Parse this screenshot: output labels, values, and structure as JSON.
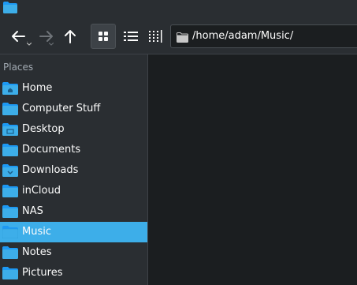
{
  "window": {
    "app_icon": "folder-icon"
  },
  "toolbar": {
    "back_icon": "back-arrow-icon",
    "forward_icon": "forward-arrow-icon",
    "up_icon": "up-arrow-icon",
    "view_modes": [
      "icons-view-icon",
      "details-view-icon",
      "compact-view-icon"
    ],
    "active_view": "icons-view-icon",
    "path": "/home/adam/Music/"
  },
  "sidebar": {
    "heading": "Places",
    "items": [
      {
        "label": "Home",
        "icon": "home-folder-icon",
        "selected": false
      },
      {
        "label": "Computer Stuff",
        "icon": "folder-icon",
        "selected": false
      },
      {
        "label": "Desktop",
        "icon": "desktop-folder-icon",
        "selected": false
      },
      {
        "label": "Documents",
        "icon": "documents-folder-icon",
        "selected": false
      },
      {
        "label": "Downloads",
        "icon": "downloads-folder-icon",
        "selected": false
      },
      {
        "label": "inCloud",
        "icon": "folder-icon",
        "selected": false
      },
      {
        "label": "NAS",
        "icon": "folder-icon",
        "selected": false
      },
      {
        "label": "Music",
        "icon": "music-folder-icon",
        "selected": true
      },
      {
        "label": "Notes",
        "icon": "folder-icon",
        "selected": false
      },
      {
        "label": "Pictures",
        "icon": "pictures-folder-icon",
        "selected": false
      }
    ]
  },
  "colors": {
    "accent": "#3daee9",
    "folder": "#1d99f3",
    "background": "#2a2e32",
    "view_background": "#1b1e20"
  }
}
